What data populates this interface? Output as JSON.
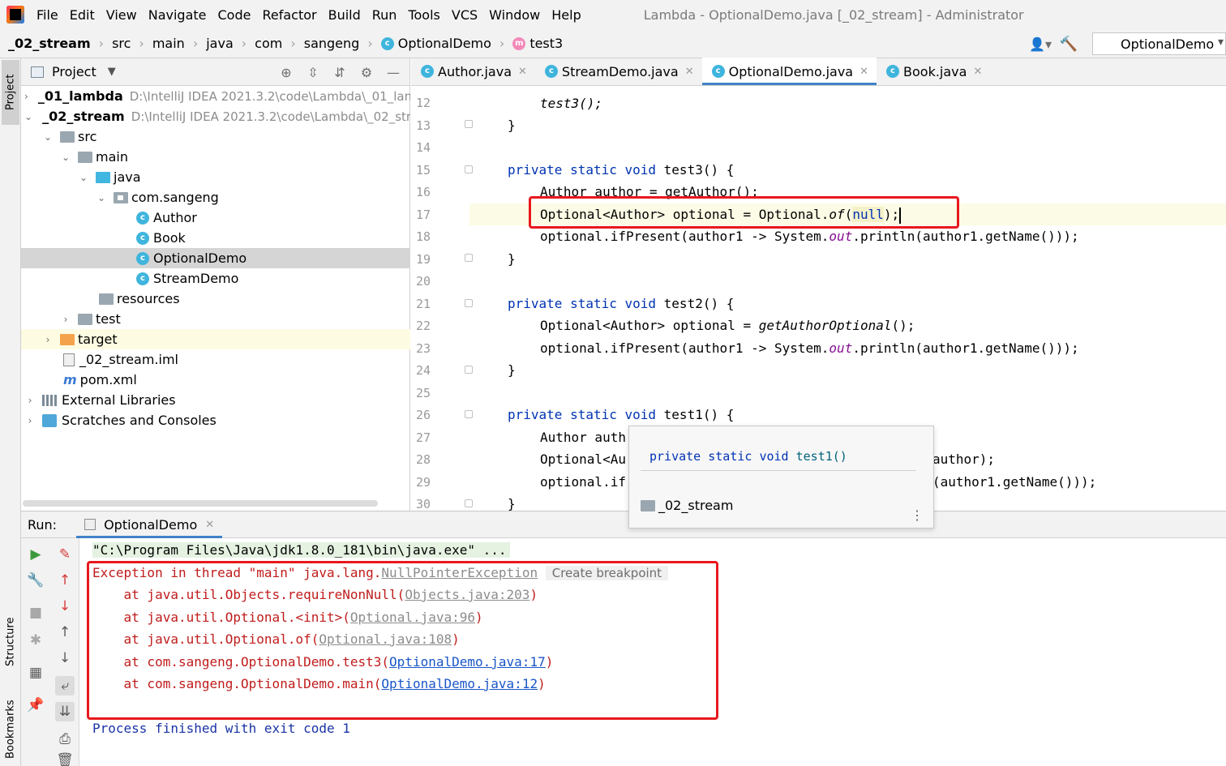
{
  "window": {
    "title": "Lambda - OptionalDemo.java [_02_stream] - Administrator"
  },
  "menu": [
    "File",
    "Edit",
    "View",
    "Navigate",
    "Code",
    "Refactor",
    "Build",
    "Run",
    "Tools",
    "VCS",
    "Window",
    "Help"
  ],
  "breadcrumb": [
    "_02_stream",
    "src",
    "main",
    "java",
    "com",
    "sangeng",
    "OptionalDemo",
    "test3"
  ],
  "run_config": "OptionalDemo",
  "left_stripe": {
    "project": "Project",
    "structure": "Structure",
    "bookmarks": "Bookmarks"
  },
  "project_panel": {
    "title": "Project",
    "tree": [
      {
        "label": "_01_lambda",
        "path": "D:\\IntelliJ IDEA 2021.3.2\\code\\Lambda\\_01_lam"
      },
      {
        "label": "_02_stream",
        "path": "D:\\IntelliJ IDEA 2021.3.2\\code\\Lambda\\_02_stre"
      },
      {
        "label": "src"
      },
      {
        "label": "main"
      },
      {
        "label": "java"
      },
      {
        "label": "com.sangeng"
      },
      {
        "label": "Author"
      },
      {
        "label": "Book"
      },
      {
        "label": "OptionalDemo"
      },
      {
        "label": "StreamDemo"
      },
      {
        "label": "resources"
      },
      {
        "label": "test"
      },
      {
        "label": "target"
      },
      {
        "label": "_02_stream.iml"
      },
      {
        "label": "pom.xml"
      },
      {
        "label": "External Libraries"
      },
      {
        "label": "Scratches and Consoles"
      }
    ]
  },
  "editor_tabs": [
    {
      "label": "Author.java",
      "active": false
    },
    {
      "label": "StreamDemo.java",
      "active": false
    },
    {
      "label": "OptionalDemo.java",
      "active": true
    },
    {
      "label": "Book.java",
      "active": false
    }
  ],
  "editor": {
    "line_numbers": [
      "12",
      "13",
      "14",
      "15",
      "16",
      "17",
      "18",
      "19",
      "20",
      "21",
      "22",
      "23",
      "24",
      "25",
      "26",
      "27",
      "28",
      "29",
      "30"
    ],
    "lines": {
      "l12": "test3();",
      "l15_kw": "private static void",
      "l15_name": " test3() {",
      "l16": "Author author = getAuthor();",
      "l17_a": "Optional<Author> optional = Optional.",
      "l17_of": "of",
      "l17_null": "null",
      "l17_end": ");",
      "l18_a": "optional.ifPresent(author1 -> System.",
      "l18_out": "out",
      "l18_b": ".println(author1.getName()));",
      "l21_name": " test2() {",
      "l22_a": "Optional<Author> optional = ",
      "l22_call": "getAuthorOptional",
      "l22_b": "();",
      "l26_name": " test1() {",
      "l27": "Author auth",
      "l28_a": "Optional<Au",
      "l28_b": "author);",
      "l29_a": "optional.if",
      "l29_b": "(author1.getName()));",
      "brace": "}"
    }
  },
  "doc_popup": {
    "signature_kw": "private static void",
    "signature_name": " test1()",
    "module": "_02_stream"
  },
  "run_panel": {
    "label": "Run:",
    "tab": "OptionalDemo",
    "console": {
      "cmd": "\"C:\\Program Files\\Java\\jdk1.8.0_181\\bin\\java.exe\" ...",
      "exc_prefix": "Exception in thread \"main\" java.lang.",
      "exc_class": "NullPointerException",
      "exc_hint": "Create breakpoint",
      "frames": [
        {
          "prefix": "    at java.util.Objects.requireNonNull(",
          "link": "Objects.java:203",
          "suffix": ")"
        },
        {
          "prefix": "    at java.util.Optional.<init>(",
          "link": "Optional.java:96",
          "suffix": ")"
        },
        {
          "prefix": "    at java.util.Optional.of(",
          "link": "Optional.java:108",
          "suffix": ")"
        },
        {
          "prefix": "    at com.sangeng.OptionalDemo.test3(",
          "link": "OptionalDemo.java:17",
          "suffix": ")"
        },
        {
          "prefix": "    at com.sangeng.OptionalDemo.main(",
          "link": "OptionalDemo.java:12",
          "suffix": ")"
        }
      ],
      "exit": "Process finished with exit code 1"
    }
  },
  "colors": {
    "keyword": "#0033b3",
    "error_text": "#c01c1c",
    "annotation_box": "#e8181d",
    "link": "#1a56c8"
  }
}
